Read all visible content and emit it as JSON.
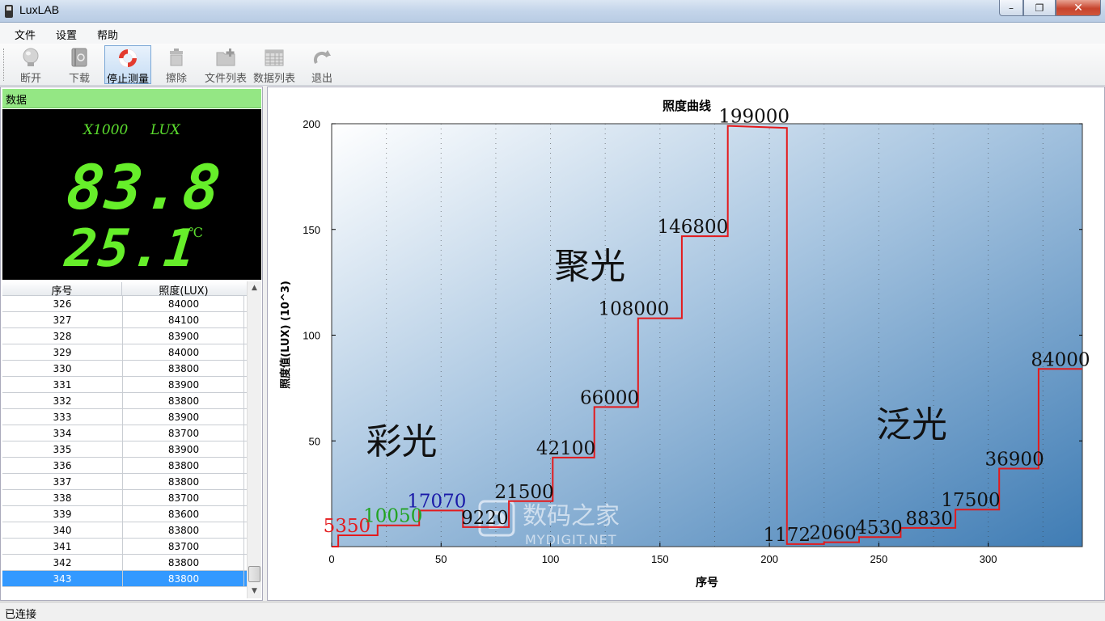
{
  "window": {
    "title": "LuxLAB",
    "min": "–",
    "max": "❐",
    "close": "✕"
  },
  "menu": [
    "文件",
    "设置",
    "帮助"
  ],
  "toolbar": [
    {
      "label": "断开",
      "icon": "bulb-icon"
    },
    {
      "label": "下载",
      "icon": "book-download-icon"
    },
    {
      "label": "停止测量",
      "icon": "lifebuoy-icon",
      "active": true
    },
    {
      "label": "擦除",
      "icon": "trash-icon"
    },
    {
      "label": "文件列表",
      "icon": "folder-add-icon"
    },
    {
      "label": "数据列表",
      "icon": "spreadsheet-icon"
    },
    {
      "label": "退出",
      "icon": "redo-arrow-icon"
    }
  ],
  "panel": {
    "title": "数据"
  },
  "lcd": {
    "scale": "X1000",
    "unit": "LUX",
    "value": "83.8",
    "temperature": "25.1",
    "temp_unit": "℃",
    "color": "#66ee2a"
  },
  "table": {
    "headers": [
      "序号",
      "照度(LUX)"
    ],
    "rows": [
      [
        "326",
        "84000"
      ],
      [
        "327",
        "84100"
      ],
      [
        "328",
        "83900"
      ],
      [
        "329",
        "84000"
      ],
      [
        "330",
        "83800"
      ],
      [
        "331",
        "83900"
      ],
      [
        "332",
        "83800"
      ],
      [
        "333",
        "83900"
      ],
      [
        "334",
        "83700"
      ],
      [
        "335",
        "83900"
      ],
      [
        "336",
        "83800"
      ],
      [
        "337",
        "83800"
      ],
      [
        "338",
        "83700"
      ],
      [
        "339",
        "83600"
      ],
      [
        "340",
        "83800"
      ],
      [
        "341",
        "83700"
      ],
      [
        "342",
        "83800"
      ],
      [
        "343",
        "83800"
      ]
    ],
    "selected_row": 17
  },
  "chart_data": {
    "type": "line",
    "title": "照度曲线",
    "xlabel": "序号",
    "ylabel": "照度值(LUX)  (10^3)",
    "xlim": [
      0,
      343
    ],
    "ylim": [
      0,
      200
    ],
    "xticks": [
      0,
      50,
      100,
      150,
      200,
      250,
      300
    ],
    "yticks": [
      50,
      100,
      150,
      200
    ],
    "grid": "dotted vertical",
    "line_color": "#e41a1c",
    "series": [
      {
        "x": [
          0,
          3,
          3,
          21,
          21,
          40,
          40,
          60,
          60,
          81,
          81,
          101,
          101,
          120,
          120,
          140,
          140,
          160,
          160,
          181,
          181,
          208,
          208,
          225,
          225,
          241,
          241,
          260,
          260,
          285,
          285,
          305,
          305,
          323,
          323,
          343
        ],
        "y": [
          0,
          0,
          5.35,
          5.35,
          10.05,
          10.05,
          17.07,
          17.07,
          9.22,
          9.22,
          21.5,
          21.5,
          42.1,
          42.1,
          66,
          66,
          108,
          108,
          146.8,
          146.8,
          199,
          198,
          1.17,
          1.17,
          2.06,
          2.06,
          4.53,
          4.53,
          8.83,
          8.83,
          17.5,
          17.5,
          36.9,
          36.9,
          84,
          84
        ]
      }
    ],
    "point_labels": [
      {
        "text": "5350",
        "x": 7,
        "y": 5.35,
        "color": "#e41a1c"
      },
      {
        "text": "10050",
        "x": 28,
        "y": 10.05,
        "color": "#21a321"
      },
      {
        "text": "17070",
        "x": 48,
        "y": 17.07,
        "color": "#1a1aa8"
      },
      {
        "text": "9220",
        "x": 70,
        "y": 9.22,
        "color": "#111111"
      },
      {
        "text": "21500",
        "x": 88,
        "y": 21.5,
        "color": "#111111"
      },
      {
        "text": "42100",
        "x": 107,
        "y": 42.1,
        "color": "#111111"
      },
      {
        "text": "66000",
        "x": 127,
        "y": 66,
        "color": "#111111"
      },
      {
        "text": "108000",
        "x": 138,
        "y": 108,
        "color": "#111111"
      },
      {
        "text": "146800",
        "x": 165,
        "y": 146.8,
        "color": "#111111"
      },
      {
        "text": "199000",
        "x": 193,
        "y": 199,
        "color": "#111111"
      },
      {
        "text": "1172",
        "x": 208,
        "y": 1.17,
        "color": "#111111"
      },
      {
        "text": "2060",
        "x": 229,
        "y": 2.06,
        "color": "#111111"
      },
      {
        "text": "4530",
        "x": 250,
        "y": 4.53,
        "color": "#111111"
      },
      {
        "text": "8830",
        "x": 273,
        "y": 8.83,
        "color": "#111111"
      },
      {
        "text": "17500",
        "x": 292,
        "y": 17.5,
        "color": "#111111"
      },
      {
        "text": "36900",
        "x": 312,
        "y": 36.9,
        "color": "#111111"
      },
      {
        "text": "84000",
        "x": 333,
        "y": 84,
        "color": "#111111"
      }
    ],
    "annotations": [
      {
        "text": "彩光",
        "x": 32,
        "y": 44
      },
      {
        "text": "聚光",
        "x": 118,
        "y": 127
      },
      {
        "text": "泛光",
        "x": 265,
        "y": 52
      }
    ],
    "watermark": {
      "text1": "数码之家",
      "text2": "MYDIGIT.NET",
      "badge": "D"
    }
  },
  "status": {
    "text": "已连接"
  }
}
